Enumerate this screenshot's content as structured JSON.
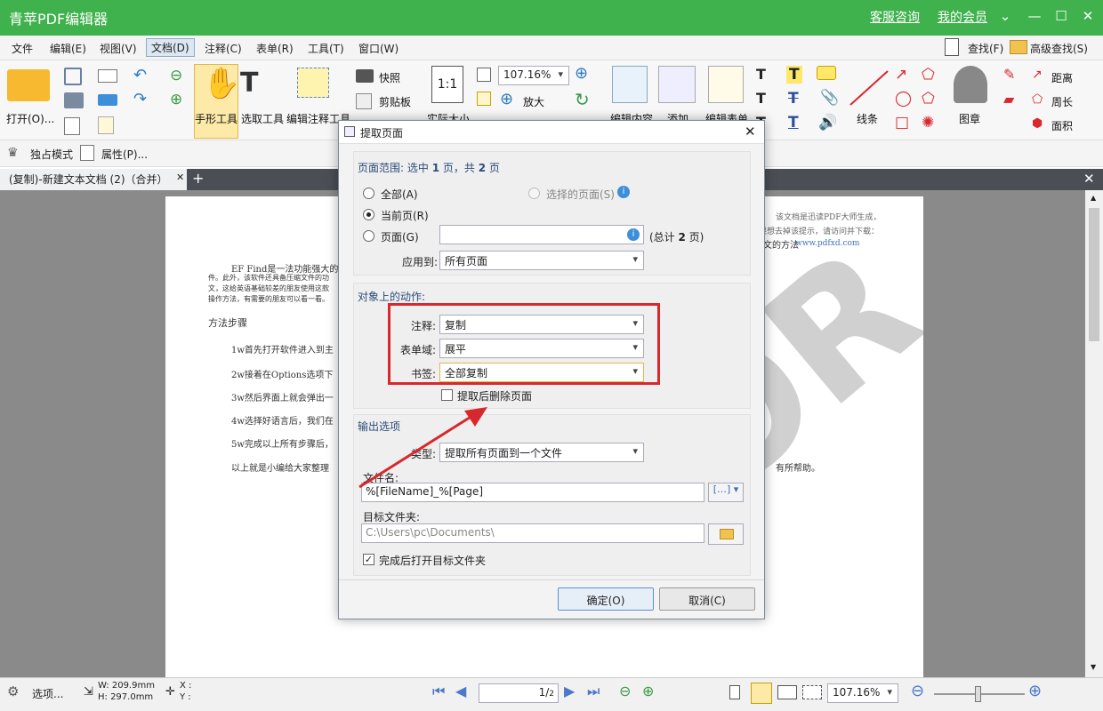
{
  "app": {
    "title": "青苹PDF编辑器",
    "service": "客服咨询",
    "member": "我的会员"
  },
  "menu": [
    "文件",
    "编辑(E)",
    "视图(V)",
    "文档(D)",
    "注释(C)",
    "表单(R)",
    "工具(T)",
    "窗口(W)"
  ],
  "search": {
    "find": "查找(F)",
    "advanced": "高级查找(S)"
  },
  "ribbon": {
    "open": "打开(O)...",
    "hand": "手形工具",
    "select_text": "选取工具",
    "select_annot": "编辑注释工具",
    "snapshot": "快照",
    "clipboard": "剪贴板",
    "actual_size": "实际大小",
    "zoom_value": "107.16%",
    "zoom_in": "放大",
    "edit_content": "编辑内容",
    "add": "添加",
    "edit_form": "编辑表单",
    "lines": "线条",
    "stamp": "图章",
    "distance": "距离",
    "perimeter": "周长",
    "area": "面积"
  },
  "subbar": {
    "exclusive": "独占模式",
    "properties": "属性(P)..."
  },
  "tab": {
    "label": "(复制)-新建文本文档 (2)（合并）"
  },
  "doc": {
    "header_line1": "该文档是迅读PDF大师生成，",
    "header_line2": "如果想去掉该提示，请访问并下载：",
    "header_link": "www.pdfxd.com",
    "method_frag": "文的方法",
    "para1a": "EF Find是一法功能强大的",
    "para1b": "件。此外，该软件还具备压缩文件的功",
    "para1c": "文，这给英语基础较差的朋友使用这款",
    "para1d": "操作方法，有需要的朋友可以看一看。",
    "section": "方法步骤",
    "steps": [
      "1w首先打开软件进入到主",
      "2w接着在Options选项下",
      "3w然后界面上就会弹出一",
      "4w选择好语言后，我们在",
      "5w完成以上所有步骤后，"
    ],
    "closing": "以上就是小编给大家整理",
    "closing_tail": "有所帮助。",
    "watermark": "TOR"
  },
  "status": {
    "options": "选项...",
    "w": "W: 209.9mm",
    "h": "H: 297.0mm",
    "x": "X :",
    "y": "Y :",
    "page": "1",
    "pages": "2",
    "zoom": "107.16%"
  },
  "dialog": {
    "title": "提取页面",
    "range_header_pre": "页面范围: 选中 ",
    "range_sel": "1",
    "range_mid": " 页，共 ",
    "range_total": "2",
    "range_post": " 页",
    "opt_all": "全部(A)",
    "opt_selected": "选择的页面(S)",
    "opt_current": "当前页(R)",
    "opt_pages": "页面(G)",
    "total_pre": "(总计 ",
    "total_val": "2",
    "total_post": " 页)",
    "apply_label": "应用到:",
    "apply_value": "所有页面",
    "actions_header": "对象上的动作:",
    "annot_label": "注释:",
    "annot_value": "复制",
    "form_label": "表单域:",
    "form_value": "展平",
    "bookmark_label": "书签:",
    "bookmark_value": "全部复制",
    "delete_after": "提取后删除页面",
    "output_header": "输出选项",
    "type_label": "类型:",
    "type_value": "提取所有页面到一个文件",
    "filename_label": "文件名:",
    "filename_value": "%[FileName]_%[Page]",
    "folder_label": "目标文件夹:",
    "folder_value": "C:\\Users\\pc\\Documents\\",
    "open_after": "完成后打开目标文件夹",
    "ok": "确定(O)",
    "cancel": "取消(C)"
  },
  "colors": {
    "titlebar": "#3fb14d",
    "highlight_box": "#d9272e",
    "arrow": "#d9272e"
  }
}
